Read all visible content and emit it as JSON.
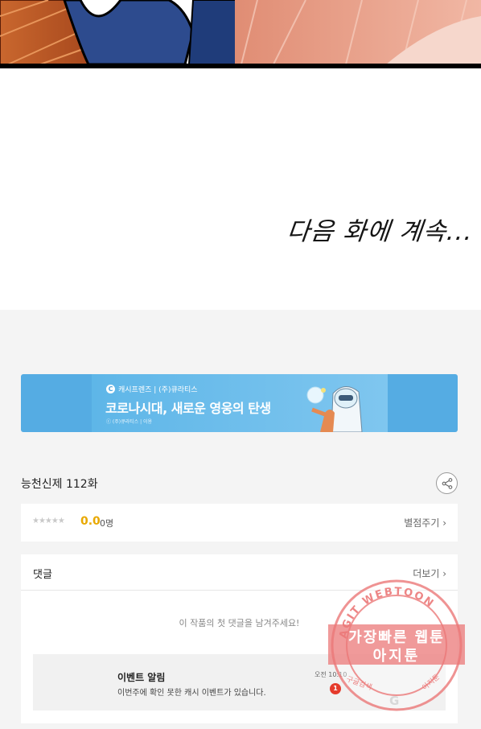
{
  "comic": {
    "caption": "다음 화에 계속..."
  },
  "banner": {
    "brand": "캐시프렌즈 | (주)큐라티스",
    "logo": "C",
    "headline": "코로나시대, 새로운 영웅의 탄생",
    "sub": "ⓒ (주)큐라티스  |  이용"
  },
  "episode": {
    "title": "능천신제 112화",
    "share_icon": "share-icon"
  },
  "rating": {
    "stars": "★★★★★",
    "score": "0.0",
    "count": "0명",
    "rate_label": "별점주기 ›"
  },
  "comments": {
    "title": "댓글",
    "more_label": "더보기 ›",
    "empty_text": "이 작품의 첫 댓글을 남겨주세요!",
    "event": {
      "title": "이벤트 알림",
      "desc": "이번주에 확인 못한 캐시 이벤트가 있습니다.",
      "time": "오전 10:10",
      "badge": "1"
    }
  },
  "watermark": {
    "ring_text": "AGIT WEBTOON",
    "line1": "가장빠른 웹툰",
    "line2": "아지툰",
    "left_text": "구글검색",
    "right_text": "아지툰",
    "google": "G"
  },
  "colors": {
    "accent_score": "#e8a800",
    "banner_blue": "#55ace3",
    "badge_red": "#e53b2c",
    "watermark_pink": "#eb7878"
  }
}
